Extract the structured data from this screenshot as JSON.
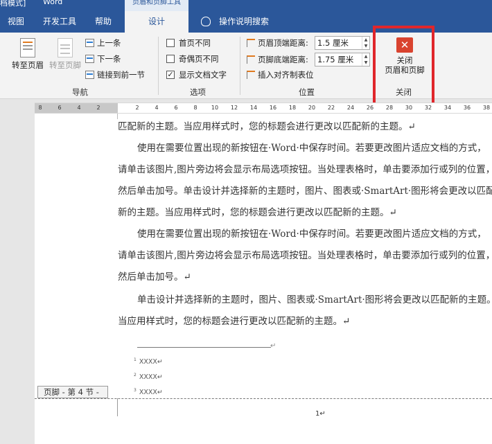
{
  "titlebar": {
    "left_fragment": "档模式]",
    "app_fragment": "Word",
    "context_label": "页眉和页脚工具"
  },
  "tabs": [
    {
      "label": "视图"
    },
    {
      "label": "开发工具"
    },
    {
      "label": "帮助"
    },
    {
      "label": "设计",
      "active": true
    }
  ],
  "tell_me": "操作说明搜索",
  "ribbon": {
    "nav": {
      "goto_header": "转至页眉",
      "goto_footer": "转至页脚",
      "prev": "上一条",
      "next": "下一条",
      "link_prev": "链接到前一节",
      "label": "导航"
    },
    "options": {
      "first_page": {
        "label": "首页不同",
        "checked": false
      },
      "odd_even": {
        "label": "奇偶页不同",
        "checked": false
      },
      "show_text": {
        "label": "显示文档文字",
        "checked": true
      },
      "label": "选项",
      "checkmark": "✓"
    },
    "position": {
      "header_dist_label": "页眉顶端距离:",
      "header_dist_value": "1.5 厘米",
      "footer_dist_label": "页脚底端距离:",
      "footer_dist_value": "1.75 厘米",
      "insert_tab": "插入对齐制表位",
      "label": "位置",
      "spin_up": "▲",
      "spin_down": "▼"
    },
    "close": {
      "icon_glyph": "✕",
      "line1": "关闭",
      "line2": "页眉和页脚",
      "label": "关闭"
    }
  },
  "ruler": {
    "ticks": [
      "8",
      "6",
      "4",
      "2",
      "2",
      "4",
      "6",
      "8",
      "10",
      "12",
      "14",
      "16",
      "18",
      "20",
      "22",
      "24",
      "26",
      "28",
      "30",
      "32",
      "34",
      "36",
      "38"
    ]
  },
  "document": {
    "lines": [
      "匹配新的主题。当应用样式时，您的标题会进行更改以匹配新的主题。↵",
      "使用在需要位置出现的新按钮在·Word·中保存时间。若要更改图片适应文档的方式，",
      "请单击该图片,图片旁边将会显示布局选项按钮。当处理表格时，单击要添加行或列的位置，",
      "然后单击加号。单击设计并选择新的主题时，图片、图表或·SmartArt·图形将会更改以匹配",
      "新的主题。当应用样式时，您的标题会进行更改以匹配新的主题。↵",
      "使用在需要位置出现的新按钮在·Word·中保存时间。若要更改图片适应文档的方式，",
      "请单击该图片,图片旁边将会显示布局选项按钮。当处理表格时，单击要添加行或列的位置，",
      "然后单击加号。↵",
      "单击设计并选择新的主题时，图片、图表或·SmartArt·图形将会更改以匹配新的主题。",
      "当应用样式时，您的标题会进行更改以匹配新的主题。↵"
    ],
    "footnote_end_mark": "↵",
    "footnotes": [
      {
        "num": "1",
        "text": "XXXX↵"
      },
      {
        "num": "2",
        "text": "XXXX↵"
      },
      {
        "num": "3",
        "text": "XXXX↵"
      }
    ],
    "footer_tag": "页脚 - 第 4 节 -",
    "page_number": "1↵"
  },
  "colors": {
    "accent": "#2b579a",
    "close_icon": "#d9432f",
    "highlight_box": "#e0262b"
  }
}
